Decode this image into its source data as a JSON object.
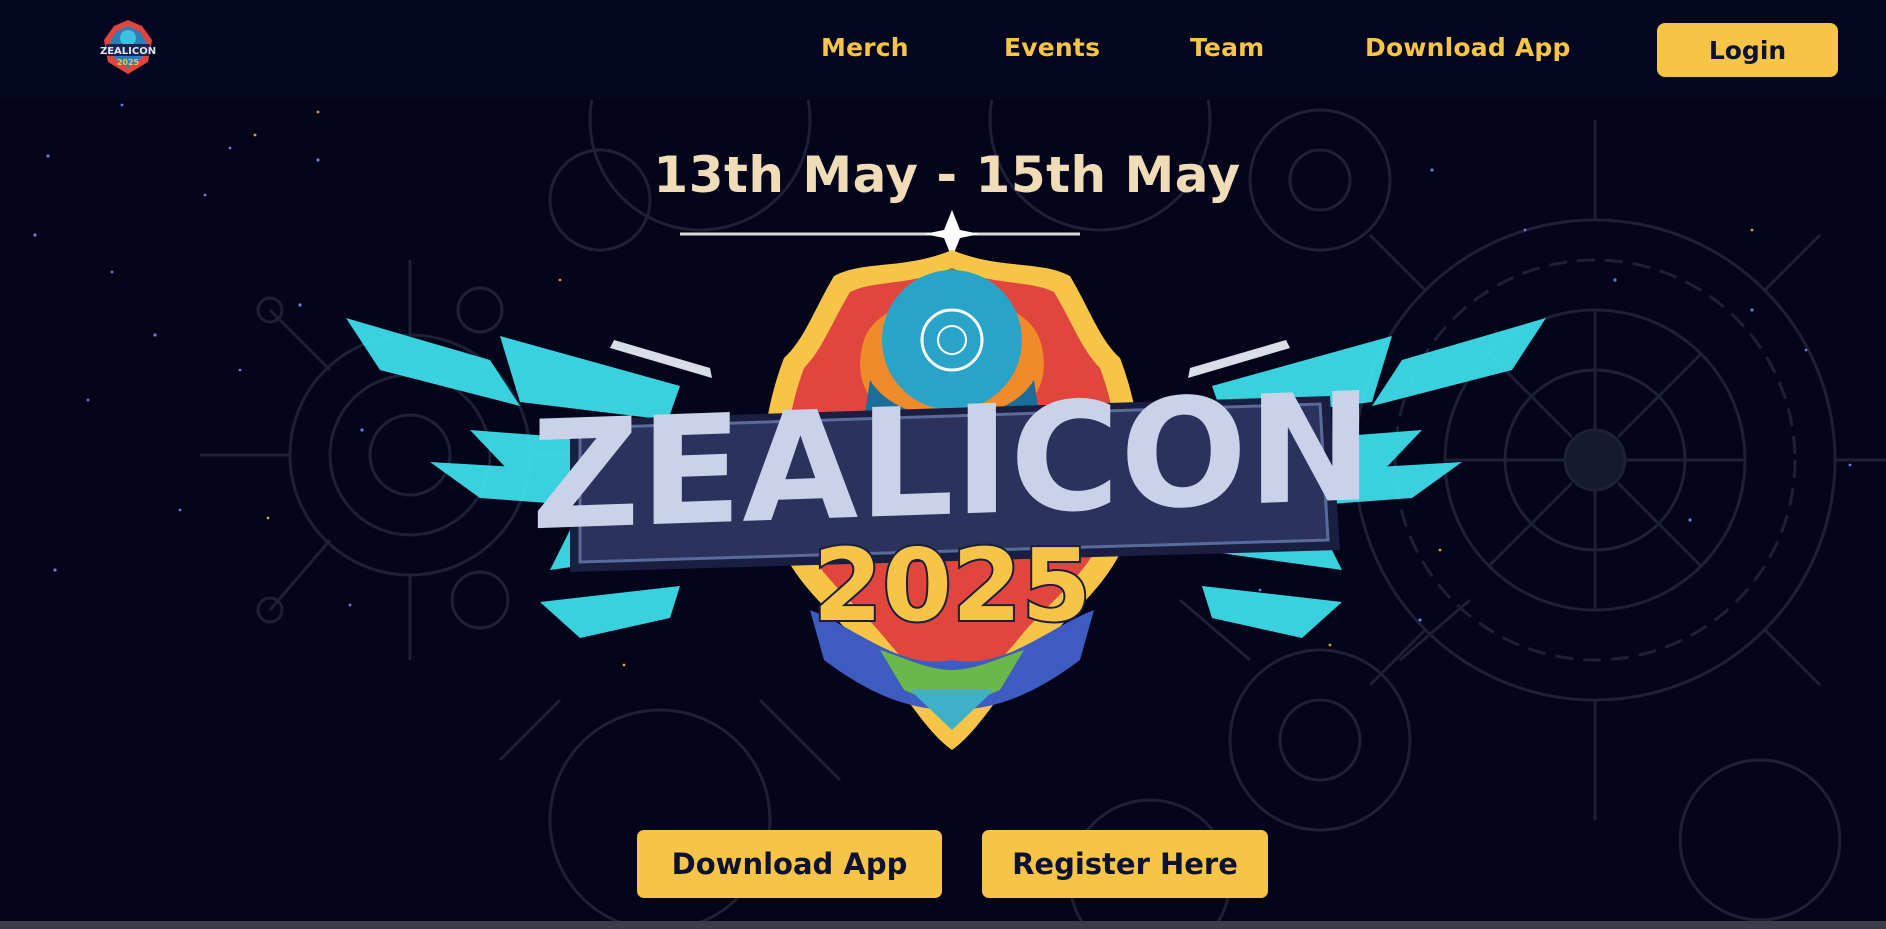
{
  "nav": {
    "logo_name": "Zealicon 2025 logo",
    "links": [
      "Merch",
      "Events",
      "Team",
      "Download App"
    ],
    "login_label": "Login"
  },
  "hero": {
    "date": "13th May - 15th May",
    "emblem_title": "ZEALICON",
    "emblem_year": "2025",
    "download_label": "Download App",
    "register_label": "Register Here"
  },
  "colors": {
    "background": "#04051a",
    "accent": "#f6c548",
    "date_text": "#f1dcb8",
    "wing_cyan": "#3fe3f0"
  }
}
